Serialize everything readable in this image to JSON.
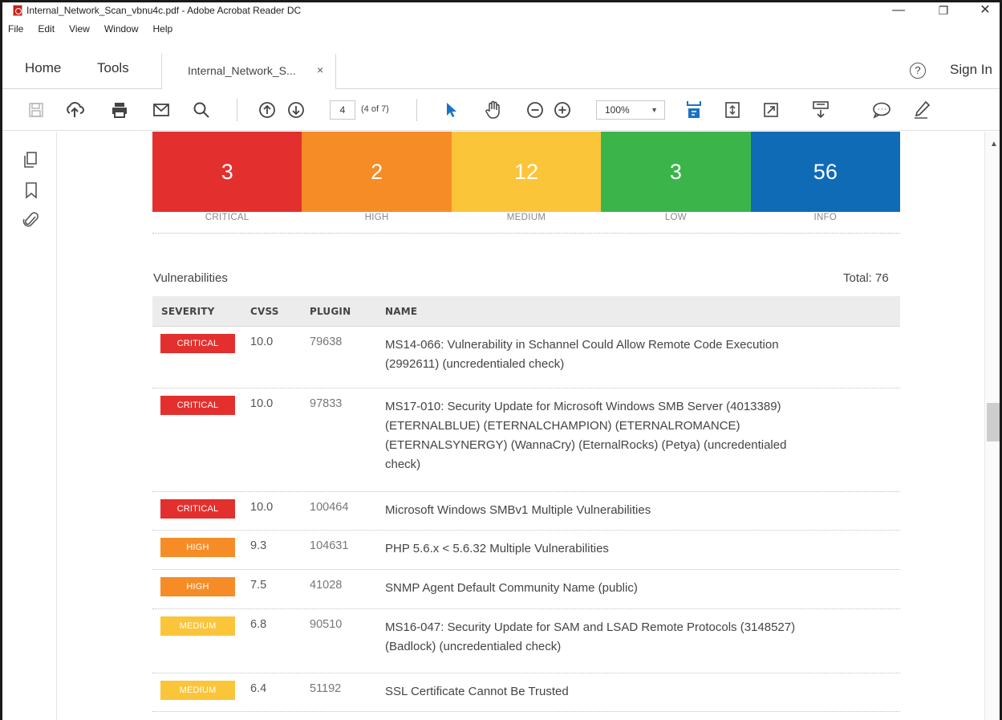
{
  "window": {
    "title": "Internal_Network_Scan_vbnu4c.pdf - Adobe Acrobat Reader DC",
    "minimize": "—",
    "maximize": "❐",
    "close": "✕"
  },
  "menu": [
    "File",
    "Edit",
    "View",
    "Window",
    "Help"
  ],
  "tabs": {
    "home": "Home",
    "tools": "Tools",
    "document": "Internal_Network_S...",
    "document_close": "×",
    "help": "?",
    "sign_in": "Sign In"
  },
  "toolbar": {
    "icons": [
      "save-icon",
      "upload-cloud-icon",
      "print-icon",
      "email-icon",
      "search-icon",
      "page-up-icon",
      "page-down-icon",
      "select-cursor-icon",
      "hand-icon",
      "zoom-out-icon",
      "zoom-in-icon",
      "fit-page-icon",
      "scroll-mode-icon",
      "full-screen-icon",
      "read-mode-icon",
      "comment-icon",
      "highlight-pen-icon"
    ],
    "page_number": "4",
    "page_of": "(4 of 7)",
    "zoom": "100%",
    "accent": "#1a73c7"
  },
  "summary": [
    {
      "label": "CRITICAL",
      "count": "3",
      "color": "#e3302e"
    },
    {
      "label": "HIGH",
      "count": "2",
      "color": "#f68c26"
    },
    {
      "label": "MEDIUM",
      "count": "12",
      "color": "#fbc53a"
    },
    {
      "label": "LOW",
      "count": "3",
      "color": "#3bb44a"
    },
    {
      "label": "INFO",
      "count": "56",
      "color": "#0f6bb6"
    }
  ],
  "vulnerabilities": {
    "title": "Vulnerabilities",
    "total": "Total: 76",
    "columns": [
      "SEVERITY",
      "CVSS",
      "PLUGIN",
      "NAME"
    ],
    "rows": [
      {
        "severity": "CRITICAL",
        "color": "#e3302e",
        "cvss": "10.0",
        "plugin": "79638",
        "lines": [
          "MS14-066: Vulnerability in Schannel Could Allow Remote Code Execution",
          "(2992611) (uncredentialed check)"
        ]
      },
      {
        "severity": "CRITICAL",
        "color": "#e3302e",
        "cvss": "10.0",
        "plugin": "97833",
        "lines": [
          "MS17-010: Security Update for Microsoft Windows SMB Server (4013389)",
          "(ETERNALBLUE) (ETERNALCHAMPION) (ETERNALROMANCE)",
          "(ETERNALSYNERGY) (WannaCry) (EternalRocks) (Petya) (uncredentialed",
          "check)"
        ]
      },
      {
        "severity": "CRITICAL",
        "color": "#e3302e",
        "cvss": "10.0",
        "plugin": "100464",
        "lines": [
          "Microsoft Windows SMBv1 Multiple Vulnerabilities"
        ]
      },
      {
        "severity": "HIGH",
        "color": "#f68c26",
        "cvss": "9.3",
        "plugin": "104631",
        "lines": [
          "PHP 5.6.x < 5.6.32 Multiple Vulnerabilities"
        ]
      },
      {
        "severity": "HIGH",
        "color": "#f68c26",
        "cvss": "7.5",
        "plugin": "41028",
        "lines": [
          "SNMP Agent Default Community Name (public)"
        ]
      },
      {
        "severity": "MEDIUM",
        "color": "#fbc53a",
        "cvss": "6.8",
        "plugin": "90510",
        "lines": [
          "MS16-047: Security Update for SAM and LSAD Remote Protocols (3148527)",
          "(Badlock) (uncredentialed check)"
        ]
      },
      {
        "severity": "MEDIUM",
        "color": "#fbc53a",
        "cvss": "6.4",
        "plugin": "51192",
        "lines": [
          "SSL Certificate Cannot Be Trusted"
        ]
      }
    ]
  }
}
